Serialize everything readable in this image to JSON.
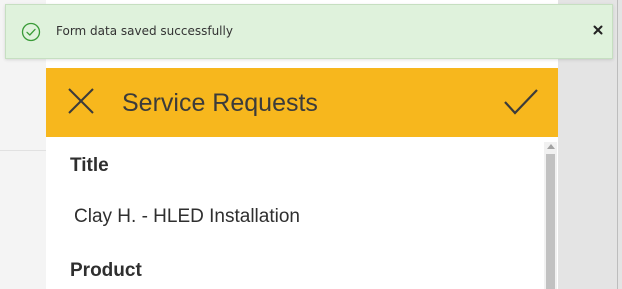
{
  "notification": {
    "message": "Form data saved successfully",
    "status": "success",
    "icon": "check-circle-icon",
    "close_icon": "close-icon",
    "background_color": "#dff2dc",
    "icon_color": "#3a9b38"
  },
  "form": {
    "title": "Service Requests",
    "header_color": "#f7b71d",
    "close_icon": "close-icon",
    "submit_icon": "checkmark-icon",
    "fields": [
      {
        "label": "Title",
        "value": "Clay H. - HLED Installation"
      },
      {
        "label": "Product",
        "value": ""
      }
    ]
  }
}
